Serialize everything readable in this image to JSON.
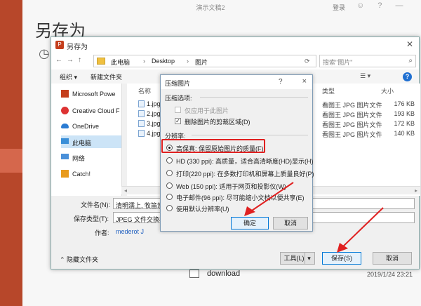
{
  "backstage": {
    "ppt_title": "演示文稿2",
    "login": "登录",
    "top_icons": "☺ ? —",
    "heading": "另存为",
    "recent_icon": "clock-icon",
    "bottom_folder": {
      "name": "download",
      "date": "2019/1/24 23:21"
    }
  },
  "dialog": {
    "title": "另存为",
    "nav_back": "←",
    "nav_forward": "→",
    "nav_up": "↑",
    "breadcrumb": [
      "此电脑",
      "Desktop",
      "图片"
    ],
    "search_placeholder": "搜索\"图片\"",
    "toolbar": {
      "organize": "组织 ▾",
      "new_folder": "新建文件夹"
    },
    "nav_items": [
      {
        "label": "Microsoft Powe",
        "icon": "powerpoint-icon"
      },
      {
        "label": "Creative Cloud F",
        "icon": "creative-cloud-icon"
      },
      {
        "label": "OneDrive",
        "icon": "onedrive-icon"
      },
      {
        "label": "此电脑",
        "icon": "computer-icon"
      },
      {
        "label": "网络",
        "icon": "network-icon"
      },
      {
        "label": "Catch!",
        "icon": "catch-icon"
      }
    ],
    "columns": {
      "name": "名称",
      "type": "类型",
      "size": "大小"
    },
    "files": [
      {
        "name": "1.jpg",
        "type": "看图王 JPG 图片文件",
        "size": "176 KB"
      },
      {
        "name": "2.jpg",
        "type": "看图王 JPG 图片文件",
        "size": "193 KB"
      },
      {
        "name": "3.jpg",
        "type": "看图王 JPG 图片文件",
        "size": "172 KB"
      },
      {
        "name": "4.jpg",
        "type": "看图王 JPG 图片文件",
        "size": "140 KB"
      }
    ],
    "filename_label": "文件名(N):",
    "filename_value": "清明濡上, 牧笛悠扬",
    "filetype_label": "保存类型(T):",
    "filetype_value": "JPEG 文件交换格式",
    "author_label": "作者:",
    "author_value": "mederot J",
    "hide_folders": "隐藏文件夹",
    "tools_button": "工具(L)",
    "save_button": "保存(S)",
    "cancel_button": "取消"
  },
  "compress": {
    "title": "压缩图片",
    "help": "?",
    "close": "×",
    "options_label": "压缩选项:",
    "apply_only": "仅应用于此图片",
    "delete_crop": "删除图片的剪裁区域(D)",
    "resolution_label": "分辨率:",
    "resolutions": [
      {
        "label": "高保真: 保留原始图片的质量(F)",
        "selected": true
      },
      {
        "label": "HD (330 ppi): 高质量，适合高清晰度(HD)显示(H)",
        "selected": false
      },
      {
        "label": "打印(220 ppi): 在多数打印机和屏幕上质量良好(P)",
        "selected": false
      },
      {
        "label": "Web (150 ppi): 适用于网页和投影仪(W)",
        "selected": false
      },
      {
        "label": "电子邮件(96 ppi): 尽可能缩小文档以便共享(E)",
        "selected": false
      },
      {
        "label": "使用默认分辨率(U)",
        "selected": false
      }
    ],
    "ok_button": "确定",
    "cancel_button": "取消"
  },
  "colors": {
    "accent_red": "#b7472a",
    "highlight_red": "#e02020",
    "link_blue": "#1f5fbf"
  }
}
